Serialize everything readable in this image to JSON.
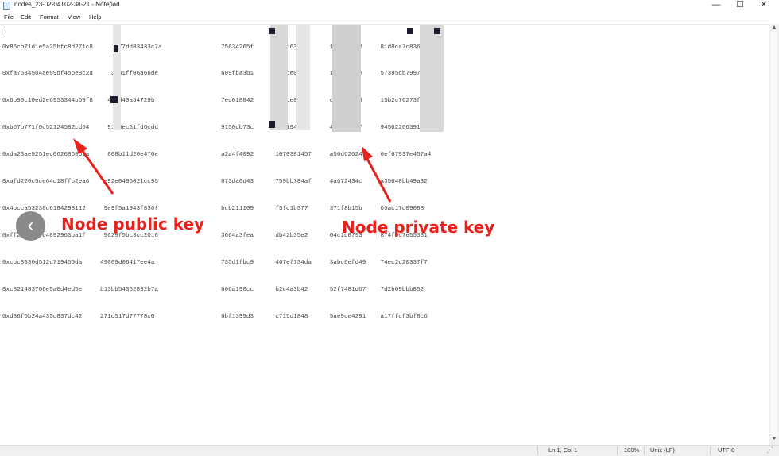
{
  "window": {
    "title": "nodes_23-02-04T02-38-21 - Notepad",
    "controls": {
      "minimize": "—",
      "maximize": "☐",
      "close": "✕"
    }
  },
  "menu": {
    "items": [
      "File",
      "Edit",
      "Format",
      "View",
      "Help"
    ]
  },
  "editor": {
    "public_keys": [
      "0x86cb71d1e5a25bfc8d271c8      277dd83433c7a",
      "0xfa7534504ae99df45be3c2a     3cb1ff06a66de",
      "0x6b90c10ed2e6953344b69f8    4f1d40a54729b",
      "0xb67b771f0c52124582cd54     9180ec51fd6cdd",
      "0xda23ae5251ec062686061a     808b11d20e470e",
      "0xafd220c5ce64d18ffb2ea6    e92e0496021cc95",
      "0x4bcca53238c6184298112     9e9f5a1943f830f",
      "0xff255ad37b4892963ba1f     9629f5bc3cc2016",
      "0xcbc3330d512d719455da     49009d06417ee4a",
      "0xc821483706e5a0d4ed5e     b13bb54362832b7a",
      "0xd86f6b24a435c837dc42     271d517d77778c0"
    ],
    "private_keys": [
      "75634265f      792d630cb      1aa5f14c2     81d8ca7c836c7c",
      "609fba3b1      5face0abf      1050bd9ce     57395db7997006",
      "7ed018842      91ede01ef      c358fb438     15b2c76273f6ae",
      "9150db73c      388194ecb      4ecdc5457     9450226639130c",
      "a2a4f4092      1070381457     a56d62624     6ef67937e457a4",
      "873da0d43      759bb784af     4a672434c     a35648bb49a32",
      "bcb211109      f5fc1b377      371f8b15b     05ac17d09088",
      "3664a3fea      db42b35e2      04c1d8793     874f0d7e55331",
      "735d1fbc9      467ef734da     3abc6efd49    74ec2d20337f7",
      "606a190cc      b2c4a3b42      52f7481d67    7d2b09bbb852",
      "6bf1399d3      c715d1848      5ae9ce4291    a17ffcf3bf8c6"
    ]
  },
  "status": {
    "position": "Ln 1, Col 1",
    "zoom": "100%",
    "line_ending": "Unix (LF)",
    "encoding": "UTF-8"
  },
  "annotations": {
    "public_key_label": "Node public key",
    "private_key_label": "Node private key",
    "arrow_color": "#e8211d"
  },
  "nav": {
    "back_icon": "‹"
  }
}
